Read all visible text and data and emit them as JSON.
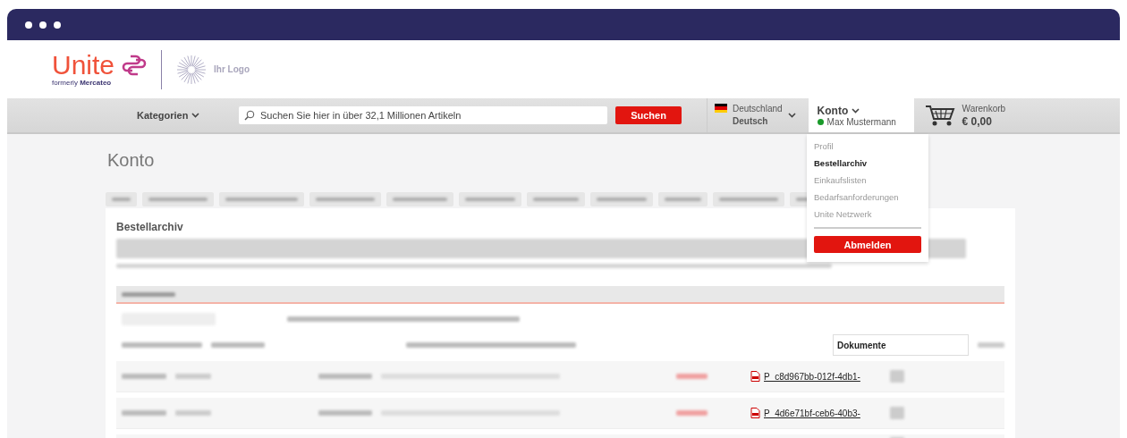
{
  "header": {
    "brand": "Unite",
    "tagline_prefix": "formerly",
    "tagline_brand": "Mercateo",
    "partner_logo": "Ihr Logo"
  },
  "nav": {
    "categories": "Kategorien",
    "search_placeholder": "Suchen Sie hier in über 32,1 Millionen Artikeln",
    "search_button": "Suchen",
    "country": "Deutschland",
    "language": "Deutsch",
    "account_label": "Konto",
    "user": "Max Mustermann",
    "online": true,
    "cart_label": "Warenkorb",
    "cart_total": "€ 0,00"
  },
  "account_menu": {
    "items": [
      {
        "label": "Profil",
        "selected": false
      },
      {
        "label": "Bestellarchiv",
        "selected": true
      },
      {
        "label": "Einkaufslisten",
        "selected": false
      },
      {
        "label": "Bedarfsanforderungen",
        "selected": false
      },
      {
        "label": "Unite Netzwerk",
        "selected": false
      }
    ],
    "logout": "Abmelden"
  },
  "page": {
    "title": "Konto",
    "section_title": "Bestellarchiv",
    "documents_header": "Dokumente",
    "rows": [
      {
        "document": "P_c8d967bb-012f-4db1-"
      },
      {
        "document": "P_4d6e71bf-ceb6-40b3-"
      }
    ]
  }
}
